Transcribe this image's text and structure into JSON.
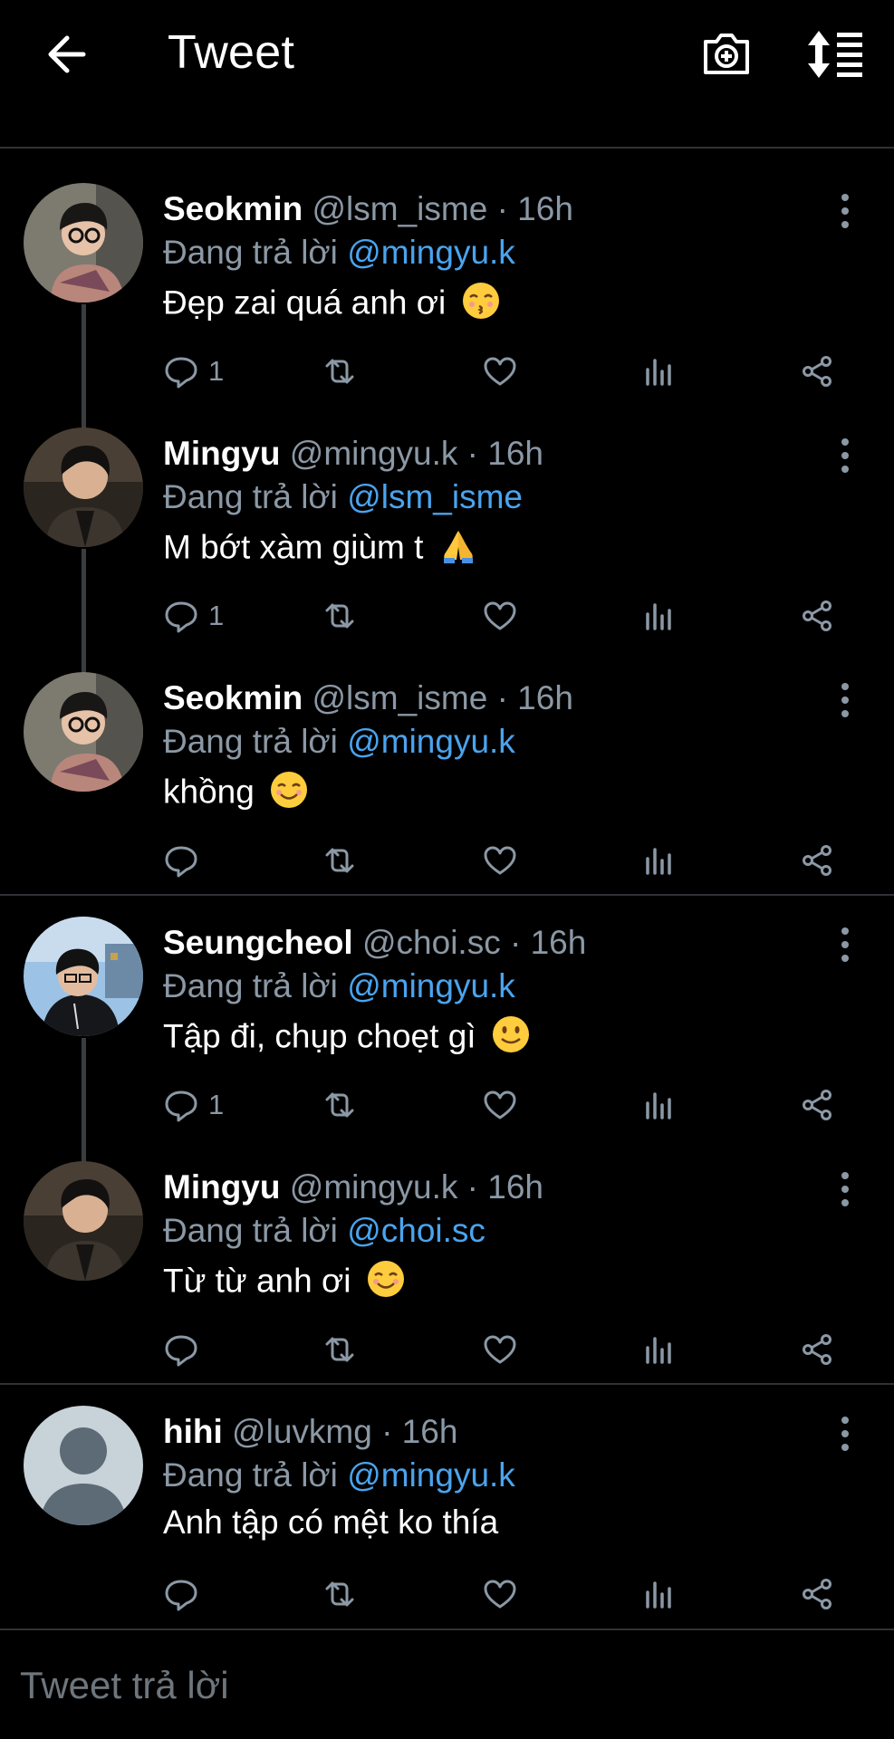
{
  "header": {
    "title": "Tweet",
    "back_icon": "arrow-left-icon",
    "camera_icon": "camera-plus-icon",
    "sort_icon": "sort-icon"
  },
  "colors": {
    "background": "#000000",
    "mention": "#4aa4ee",
    "muted": "#8b98a5",
    "divider": "#2f3336"
  },
  "tweets": [
    {
      "name": "Seokmin",
      "meta": "@lsm_isme · 16h",
      "reply_prefix": "Đang trả lời",
      "reply_to": "@mingyu.k",
      "text": "Đẹp zai quá anh ơi",
      "emoji": "kissing-face",
      "reply_count": "1"
    },
    {
      "name": "Mingyu",
      "meta": "@mingyu.k · 16h",
      "reply_prefix": "Đang trả lời",
      "reply_to": "@lsm_isme",
      "text": "M bớt xàm giùm t",
      "emoji": "folded-hands",
      "reply_count": "1"
    },
    {
      "name": "Seokmin",
      "meta": "@lsm_isme · 16h",
      "reply_prefix": "Đang trả lời",
      "reply_to": "@mingyu.k",
      "text": "khồng",
      "emoji": "smiling-face",
      "reply_count": ""
    },
    {
      "name": "Seungcheol",
      "meta": "@choi.sc · 16h",
      "reply_prefix": "Đang trả lời",
      "reply_to": "@mingyu.k",
      "text": "Tập đi, chụp choẹt gì",
      "emoji": "slight-smile",
      "reply_count": "1"
    },
    {
      "name": "Mingyu",
      "meta": "@mingyu.k · 16h",
      "reply_prefix": "Đang trả lời",
      "reply_to": "@choi.sc",
      "text": "Từ từ anh ơi",
      "emoji": "smiling-face",
      "reply_count": ""
    },
    {
      "name": "hihi",
      "meta": "@luvkmg · 16h",
      "reply_prefix": "Đang trả lời",
      "reply_to": "@mingyu.k",
      "text": "Anh tập có mệt ko thía",
      "emoji": "",
      "reply_count": ""
    }
  ],
  "compose": {
    "placeholder": "Tweet trả lời"
  }
}
